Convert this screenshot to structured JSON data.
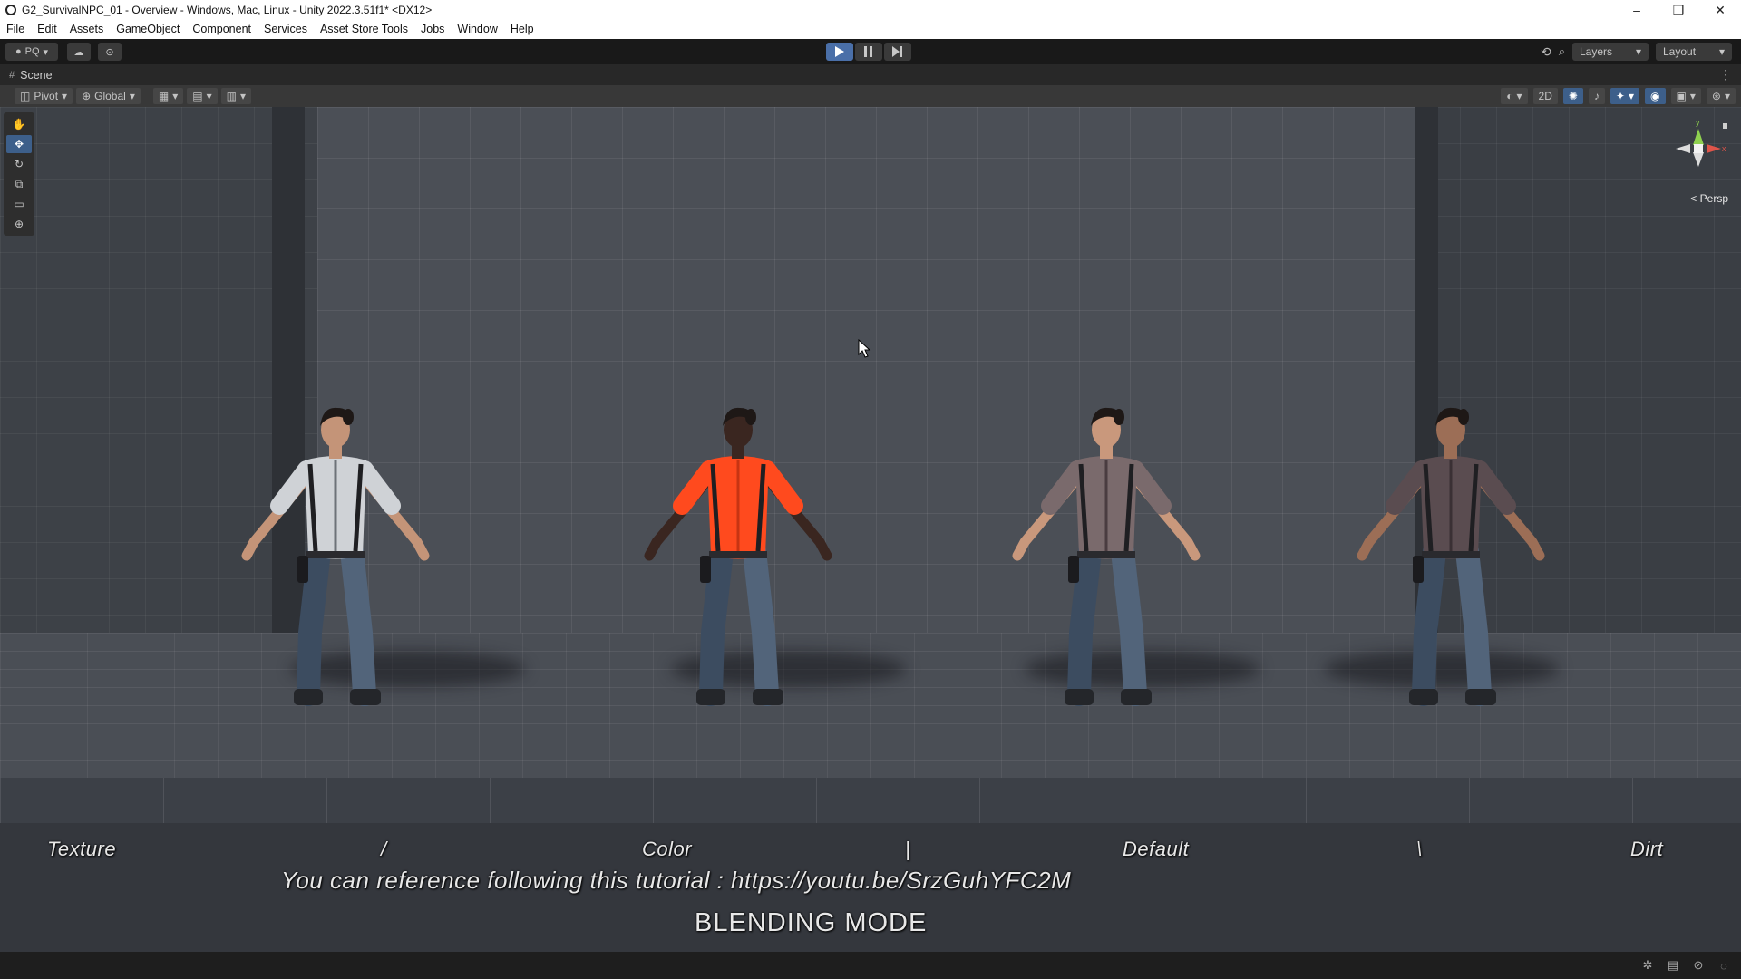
{
  "window": {
    "title": "G2_SurvivalNPC_01 - Overview - Windows, Mac, Linux - Unity 2022.3.51f1* <DX12>",
    "controls": [
      "–",
      "❐",
      "✕"
    ]
  },
  "menu": [
    "File",
    "Edit",
    "Assets",
    "GameObject",
    "Component",
    "Services",
    "Asset Store Tools",
    "Jobs",
    "Window",
    "Help"
  ],
  "main_toolbar": {
    "account_label": "PQ",
    "layers_label": "Layers",
    "layout_label": "Layout",
    "play_state": "play-active"
  },
  "scene_tab": {
    "label": "Scene"
  },
  "scene_toolbar": {
    "pivot_label": "Pivot",
    "global_label": "Global",
    "mode_2d_label": "2D"
  },
  "gizmo": {
    "projection_label": "Persp",
    "axis_labels": {
      "y": "y",
      "x": "x"
    },
    "colors": {
      "y": "#8fd14f",
      "x": "#e0554a",
      "z": "#dddddd"
    }
  },
  "characters": [
    {
      "name": "character-camo-shirt",
      "shirt_color": "#cfd2d6",
      "shirt_accent": "#6d7278",
      "skin": "#c49478"
    },
    {
      "name": "character-orange-shirt",
      "shirt_color": "#ff4a1e",
      "shirt_accent": "#c73413",
      "skin": "#3a2620"
    },
    {
      "name": "character-plaid-shirt",
      "shirt_color": "#7a6a6c",
      "shirt_accent": "#4a3c40",
      "skin": "#c9987c"
    },
    {
      "name": "character-dark-plaid-shirt",
      "shirt_color": "#5a4c50",
      "shirt_accent": "#3a3034",
      "skin": "#9c6e56"
    }
  ],
  "scene_labels": {
    "blend_modes": [
      "Texture",
      "/",
      "Color",
      "|",
      "Default",
      "\\",
      "Dirt"
    ],
    "tutorial": "You can reference following this tutorial : https://youtu.be/SrzGuhYFC2M",
    "title": "BLENDING MODE"
  }
}
